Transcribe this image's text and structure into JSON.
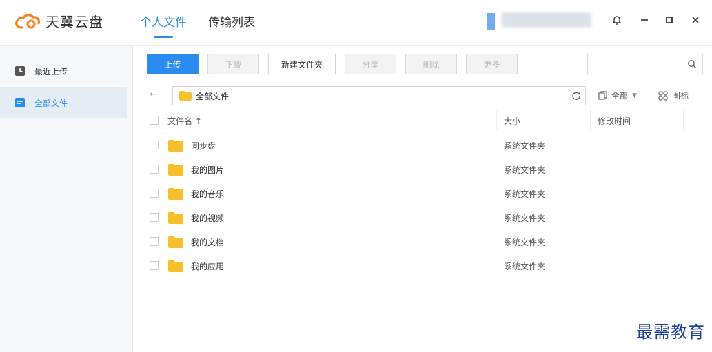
{
  "app": {
    "name": "天翼云盘"
  },
  "nav": {
    "tabs": [
      {
        "label": "个人文件",
        "active": true
      },
      {
        "label": "传输列表",
        "active": false
      }
    ]
  },
  "window_controls": [
    "bell-icon",
    "minimize-icon",
    "maximize-icon",
    "close-icon"
  ],
  "sidebar": {
    "items": [
      {
        "label": "最近上传",
        "icon": "clock-icon",
        "active": false
      },
      {
        "label": "全部文件",
        "icon": "folder-icon",
        "active": true
      }
    ]
  },
  "toolbar": {
    "upload": "上传",
    "download": "下载",
    "new_folder": "新建文件夹",
    "share": "分享",
    "delete": "删除",
    "more": "更多"
  },
  "search": {
    "placeholder": "",
    "value": ""
  },
  "path": {
    "current": "全部文件"
  },
  "view": {
    "filter": "全部",
    "mode": "图标"
  },
  "table": {
    "headers": {
      "name": "文件名 ↑",
      "size": "大小",
      "modified": "修改时间"
    }
  },
  "files": [
    {
      "name": "同步盘",
      "size": "系统文件夹"
    },
    {
      "name": "我的图片",
      "size": "系统文件夹"
    },
    {
      "name": "我的音乐",
      "size": "系统文件夹"
    },
    {
      "name": "我的视频",
      "size": "系统文件夹"
    },
    {
      "name": "我的文档",
      "size": "系统文件夹"
    },
    {
      "name": "我的应用",
      "size": "系统文件夹"
    }
  ],
  "watermark": "最需教育",
  "colors": {
    "accent": "#2a8cf0",
    "folder": "#f7c12e",
    "logo_orange": "#f5821f"
  }
}
